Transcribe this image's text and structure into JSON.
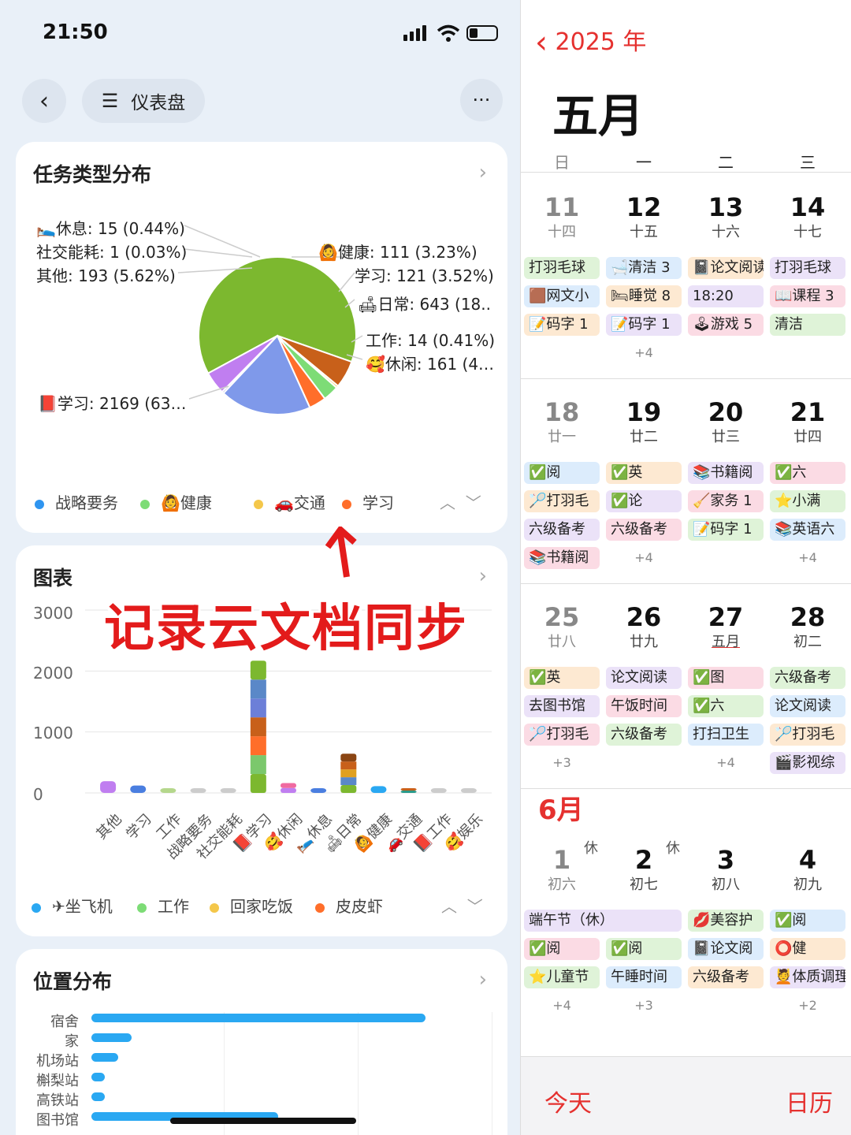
{
  "status": {
    "time": "21:50"
  },
  "nav": {
    "title": "仪表盘"
  },
  "pie_card": {
    "title": "任务类型分布",
    "labels": [
      "🛌休息: 15 (0.44%)",
      "社交能耗: 1 (0.03%)",
      "其他: 193 (5.62%)",
      "🙆健康: 111 (3.23%)",
      "学习: 121 (3.52%)",
      "🛋日常: 643 (18..",
      "工作: 14 (0.41%)",
      "🥰休闲: 161 (4…",
      "📕学习: 2169 (63…"
    ],
    "legend": [
      "战略要务",
      "🙆健康",
      "🚗交通",
      "学习"
    ]
  },
  "chart_card": {
    "title": "图表",
    "overlay": "记录云文档同步",
    "legend": [
      "✈坐飞机",
      "工作",
      "回家吃饭",
      "皮皮虾"
    ]
  },
  "location_card": {
    "title": "位置分布",
    "rows": [
      {
        "label": "宿舍",
        "value": 100
      },
      {
        "label": "家",
        "value": 12
      },
      {
        "label": "机场站",
        "value": 8
      },
      {
        "label": "槲梨站",
        "value": 4
      },
      {
        "label": "高铁站",
        "value": 4
      },
      {
        "label": "图书馆",
        "value": 56
      }
    ]
  },
  "chart_data": [
    {
      "type": "pie",
      "title": "任务类型分布",
      "slices": [
        {
          "label": "📕学习",
          "value": 2169,
          "color": "#7cb82f"
        },
        {
          "label": "其他",
          "value": 193,
          "color": "#c8601a"
        },
        {
          "label": "🛌休息",
          "value": 15,
          "color": "#f4c74a"
        },
        {
          "label": "社交能耗",
          "value": 1,
          "color": "#d9d9d9"
        },
        {
          "label": "🙆健康",
          "value": 111,
          "color": "#7ddc76"
        },
        {
          "label": "学习",
          "value": 121,
          "color": "#ff6e2a"
        },
        {
          "label": "🛋日常",
          "value": 643,
          "color": "#7f99ea"
        },
        {
          "label": "工作",
          "value": 14,
          "color": "#b0b0d8"
        },
        {
          "label": "🥰休闲",
          "value": 161,
          "color": "#c07ef0"
        }
      ]
    },
    {
      "type": "bar",
      "title": "图表",
      "categories": [
        "其他",
        "学习",
        "工作",
        "战略要务",
        "社交能耗",
        "📕学习",
        "🥰休闲",
        "🛌休息",
        "🛋日常",
        "🙆健康",
        "🚗交通",
        "📕工作",
        "🥰娱乐"
      ],
      "ylim": [
        0,
        3000
      ],
      "yticks": [
        0,
        1000,
        2000,
        3000
      ],
      "totals": [
        193,
        121,
        14,
        3,
        1,
        2169,
        161,
        15,
        643,
        111,
        70,
        14,
        5
      ],
      "stack_colors": [
        [
          "#c07ef0"
        ],
        [
          "#4a7ee0"
        ],
        [
          "#b5d78c"
        ],
        [
          "#cccccc"
        ],
        [
          "#cccccc"
        ],
        [
          "#7cb82f",
          "#7bc86c",
          "#ff6e2a",
          "#c8601a",
          "#6c7fd8",
          "#5a88c8",
          "#7cb82f"
        ],
        [
          "#c07ef0",
          "#f06aa0"
        ],
        [
          "#4a7ee0"
        ],
        [
          "#7cb82f",
          "#5a88c8",
          "#e0a020",
          "#c8601a",
          "#8b4513"
        ],
        [
          "#2aa8f2"
        ],
        [
          "#2a9a8a",
          "#c8601a"
        ],
        [
          "#cccccc"
        ],
        [
          "#cccccc"
        ]
      ]
    }
  ],
  "calendar": {
    "year_label": "2025 年",
    "month": "五月",
    "weekdays": [
      "日",
      "一",
      "二",
      "三"
    ],
    "weeks": [
      {
        "days": [
          {
            "num": "11",
            "lunar": "十四",
            "gray": true
          },
          {
            "num": "12",
            "lunar": "十五"
          },
          {
            "num": "13",
            "lunar": "十六"
          },
          {
            "num": "14",
            "lunar": "十七"
          }
        ],
        "events": [
          [
            "打羽毛球",
            "🟫网文小",
            "📝码字 1"
          ],
          [
            "🛁清洁 3",
            "🛏睡觉 8",
            "📝码字 1"
          ],
          [
            "📓论文阅读 4…",
            "18:20",
            "🕹游戏 5"
          ],
          [
            "打羽毛球",
            "📖课程 3",
            "清洁"
          ]
        ],
        "more": [
          "",
          "+4",
          "",
          ""
        ]
      },
      {
        "days": [
          {
            "num": "18",
            "lunar": "廿一",
            "gray": true
          },
          {
            "num": "19",
            "lunar": "廿二"
          },
          {
            "num": "20",
            "lunar": "廿三"
          },
          {
            "num": "21",
            "lunar": "廿四"
          }
        ],
        "events": [
          [
            "✅阅",
            "🏸打羽毛",
            "六级备考",
            "📚书籍阅"
          ],
          [
            "✅英",
            "✅论",
            "六级备考"
          ],
          [
            "📚书籍阅",
            "🧹家务 1",
            "📝码字 1"
          ],
          [
            "✅六",
            "⭐小满",
            "📚英语六"
          ]
        ],
        "more": [
          "",
          "+4",
          "",
          "+4"
        ]
      },
      {
        "days": [
          {
            "num": "25",
            "lunar": "廿八",
            "gray": true
          },
          {
            "num": "26",
            "lunar": "廿九"
          },
          {
            "num": "27",
            "lunar": "五月"
          },
          {
            "num": "28",
            "lunar": "初二"
          }
        ],
        "events": [
          [
            "✅英",
            "去图书馆",
            "🏸打羽毛"
          ],
          [
            "论文阅读",
            "午饭时间",
            "六级备考"
          ],
          [
            "✅图",
            "✅六",
            "打扫卫生"
          ],
          [
            "六级备考",
            "论文阅读",
            "🏸打羽毛",
            "🎬影视综"
          ]
        ],
        "more": [
          "+3",
          "",
          "+4",
          ""
        ]
      },
      {
        "days": [
          {
            "num": "1",
            "lunar": "初六",
            "gray": true,
            "hol": "休"
          },
          {
            "num": "2",
            "lunar": "初七",
            "hol": "休"
          },
          {
            "num": "3",
            "lunar": "初八"
          },
          {
            "num": "4",
            "lunar": "初九"
          }
        ],
        "events": [
          [
            "端午节（休）",
            "✅阅",
            "⭐儿童节"
          ],
          [
            "",
            "✅阅",
            "午睡时间"
          ],
          [
            "💋美容护",
            "📓论文阅",
            "六级备考"
          ],
          [
            "✅阅",
            "⭕健",
            "💆体质调理"
          ]
        ],
        "more": [
          "+4",
          "+3",
          "",
          "+2"
        ]
      }
    ],
    "june_label": "6月",
    "today_btn": "今天",
    "calendar_btn": "日历"
  }
}
